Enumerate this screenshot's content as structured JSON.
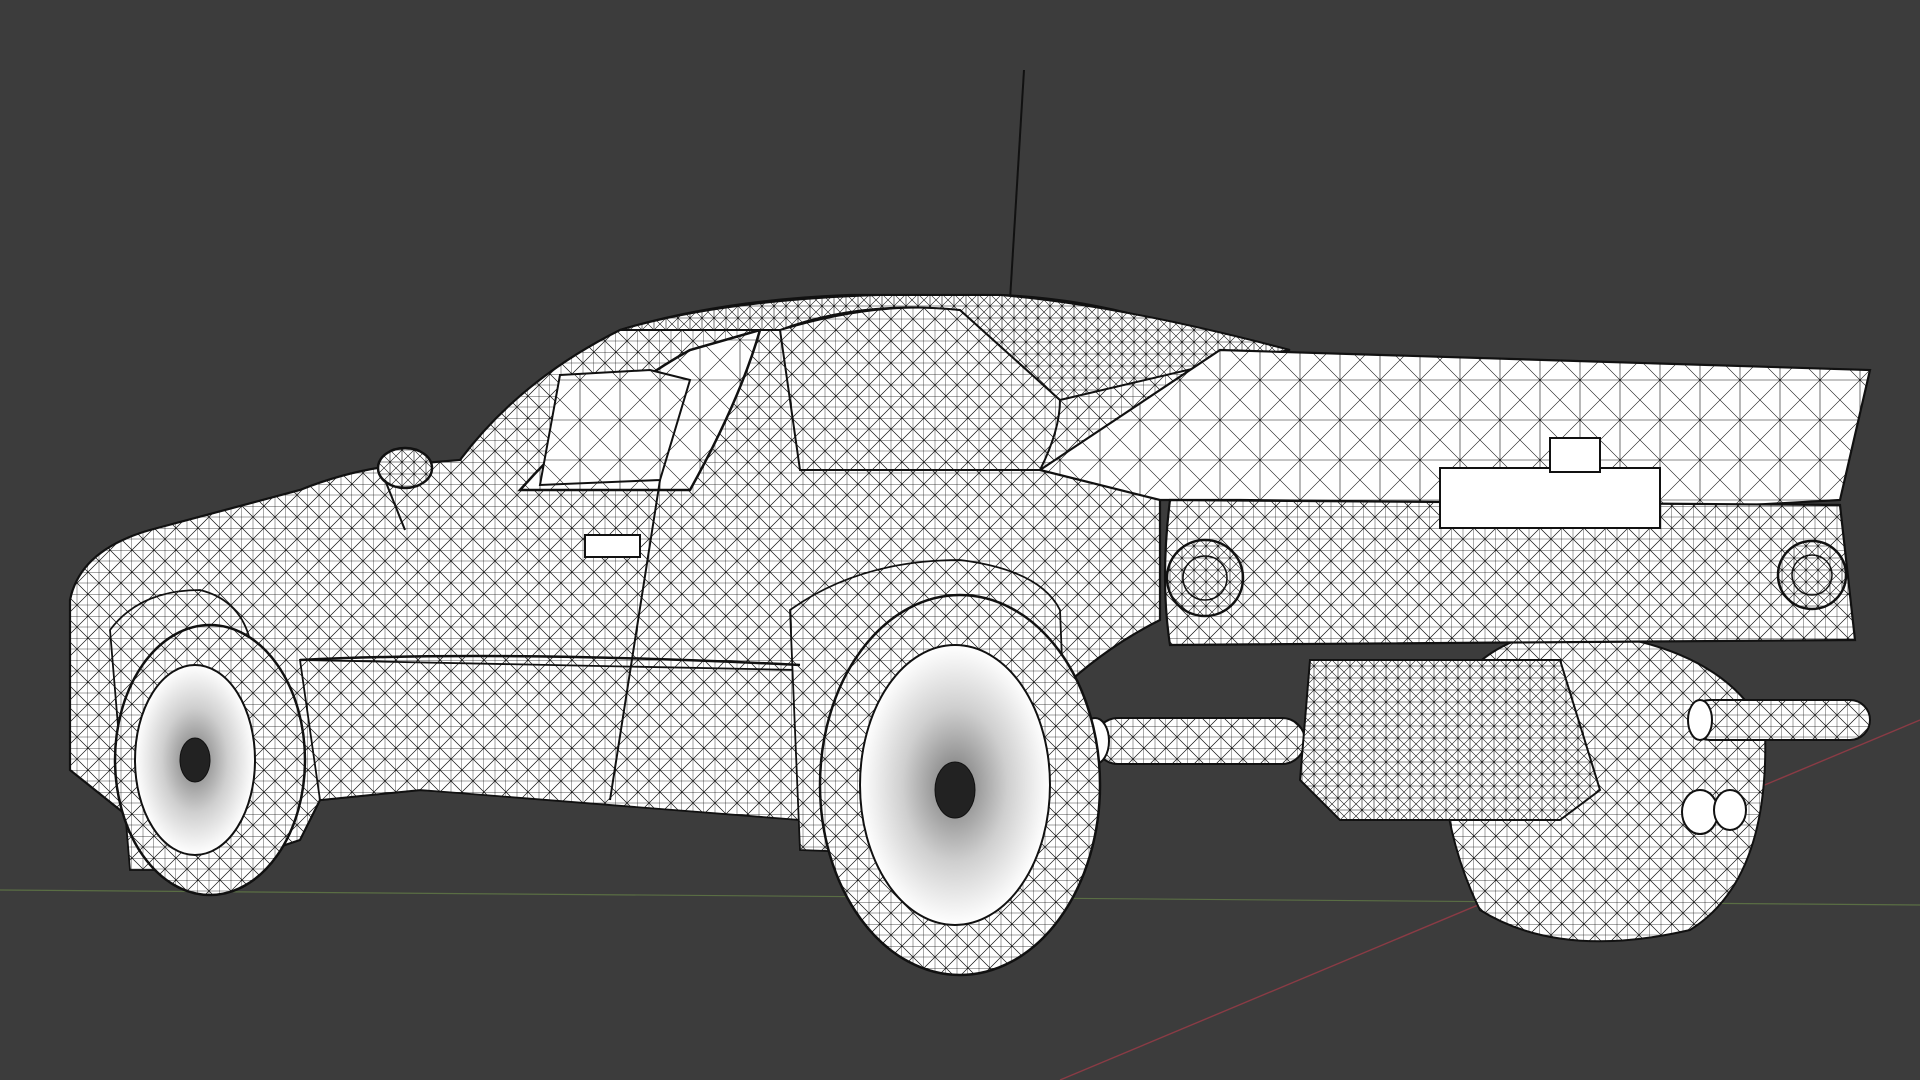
{
  "viewport": {
    "background_color": "#3c3c3c",
    "wire_color": "#111111",
    "surface_color": "#ffffff",
    "x_axis_color": "#8a3b45",
    "y_axis_color": "#5a6e44"
  },
  "scene": {
    "object": "rally-car-wireframe",
    "shading_mode": "wireframe"
  }
}
